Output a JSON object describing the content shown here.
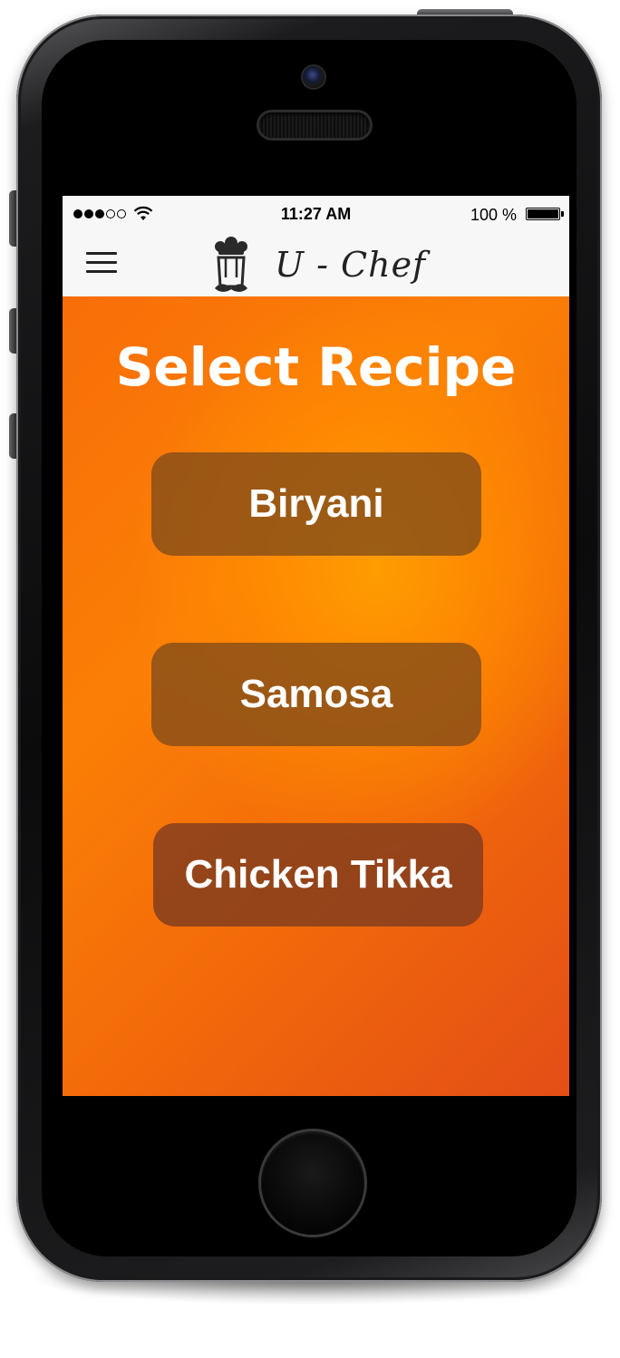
{
  "status_bar": {
    "time": "11:27 AM",
    "battery_percent": "100 %",
    "signal_bars_filled": 3,
    "signal_bars_total": 5,
    "wifi_icon": "wifi-icon",
    "battery_icon": "battery-icon"
  },
  "header": {
    "menu_icon": "hamburger-menu-icon",
    "logo_icon": "chef-hat-mustache-icon",
    "app_name": "U - Chef"
  },
  "main": {
    "title": "Select Recipe",
    "recipes": [
      {
        "label": "Biryani"
      },
      {
        "label": "Samosa"
      },
      {
        "label": "Chicken Tikka"
      }
    ]
  },
  "colors": {
    "background_orange": "#fb7f06",
    "background_deep": "#e34e16",
    "button_brown": "#804c1a",
    "header_bg": "#f7f7f7",
    "text_white": "#ffffff"
  }
}
